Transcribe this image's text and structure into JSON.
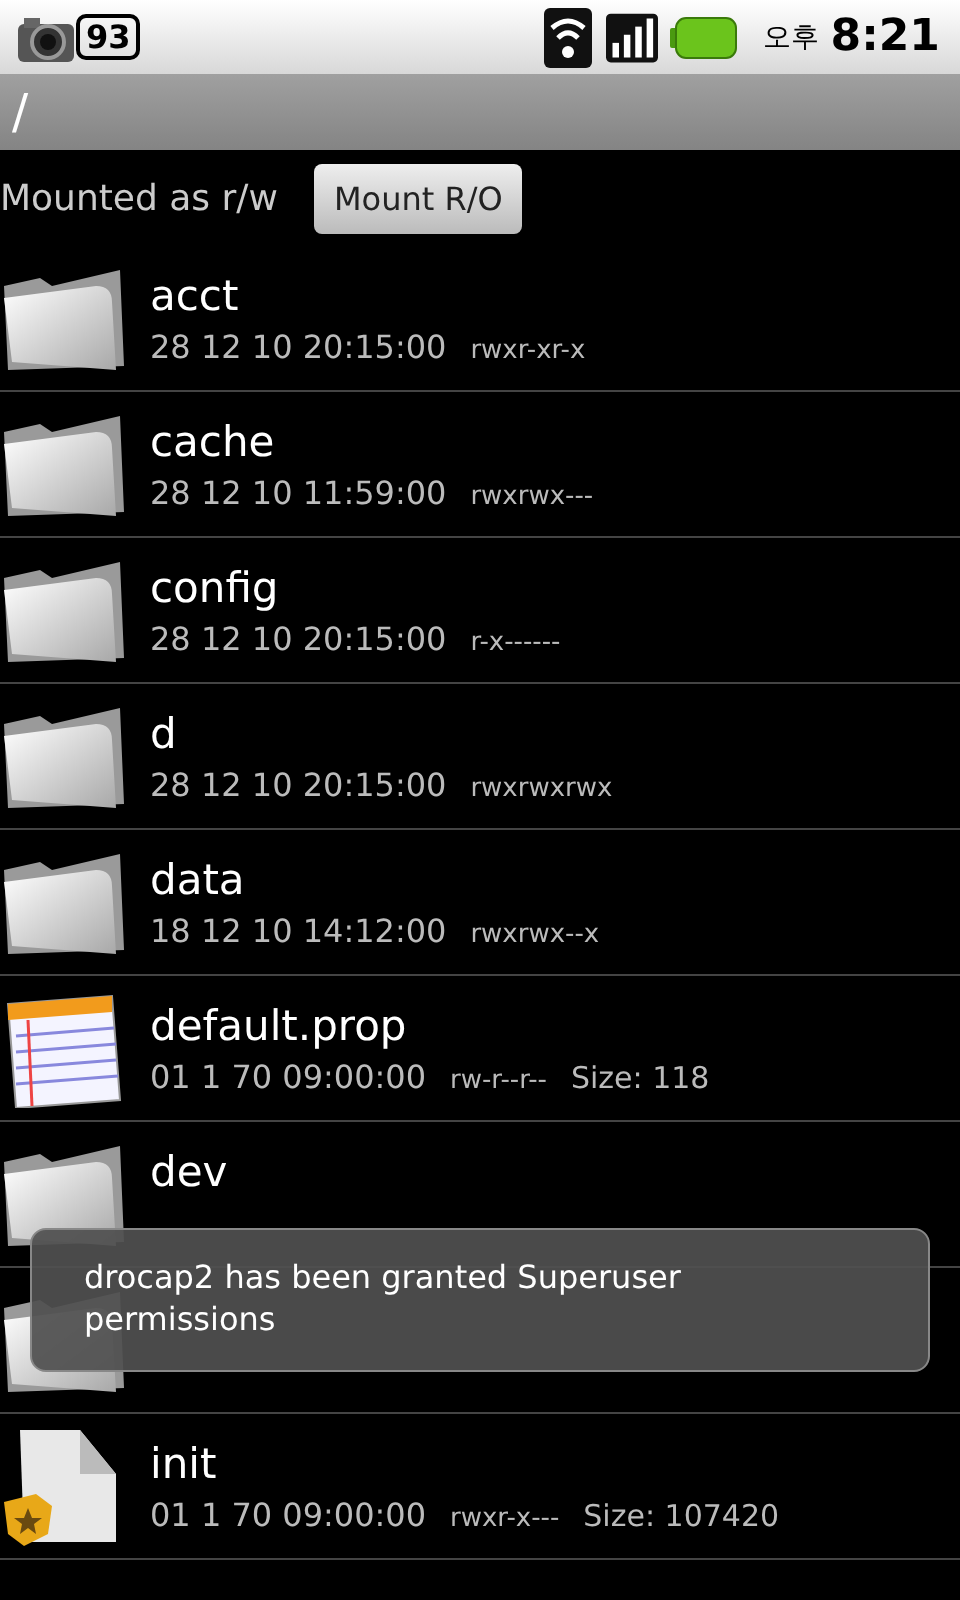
{
  "status_bar": {
    "notification_count": "93",
    "ampm": "오후",
    "time": "8:21"
  },
  "path_bar": {
    "path": "/"
  },
  "mount": {
    "status": "Mounted as r/w",
    "button": "Mount R/O"
  },
  "files": [
    {
      "kind": "folder",
      "name": "acct",
      "modified": "28 12 10 20:15:00",
      "permissions": "rwxr-xr-x"
    },
    {
      "kind": "folder",
      "name": "cache",
      "modified": "28 12 10 11:59:00",
      "permissions": "rwxrwx---"
    },
    {
      "kind": "folder",
      "name": "config",
      "modified": "28 12 10 20:15:00",
      "permissions": "r-x------"
    },
    {
      "kind": "folder",
      "name": "d",
      "modified": "28 12 10 20:15:00",
      "permissions": "rwxrwxrwx"
    },
    {
      "kind": "folder",
      "name": "data",
      "modified": "18 12 10 14:12:00",
      "permissions": "rwxrwx--x"
    },
    {
      "kind": "text",
      "name": "default.prop",
      "modified": "01 1 70 09:00:00",
      "permissions": "rw-r--r--",
      "size": "Size: 118"
    },
    {
      "kind": "folder",
      "name": "dev"
    },
    {
      "kind": "folder"
    },
    {
      "kind": "binary",
      "name": "init",
      "modified": "01 1 70 09:00:00",
      "permissions": "rwxr-x---",
      "size": "Size: 107420"
    }
  ],
  "toast": {
    "message": "drocap2 has been granted Superuser permissions"
  }
}
